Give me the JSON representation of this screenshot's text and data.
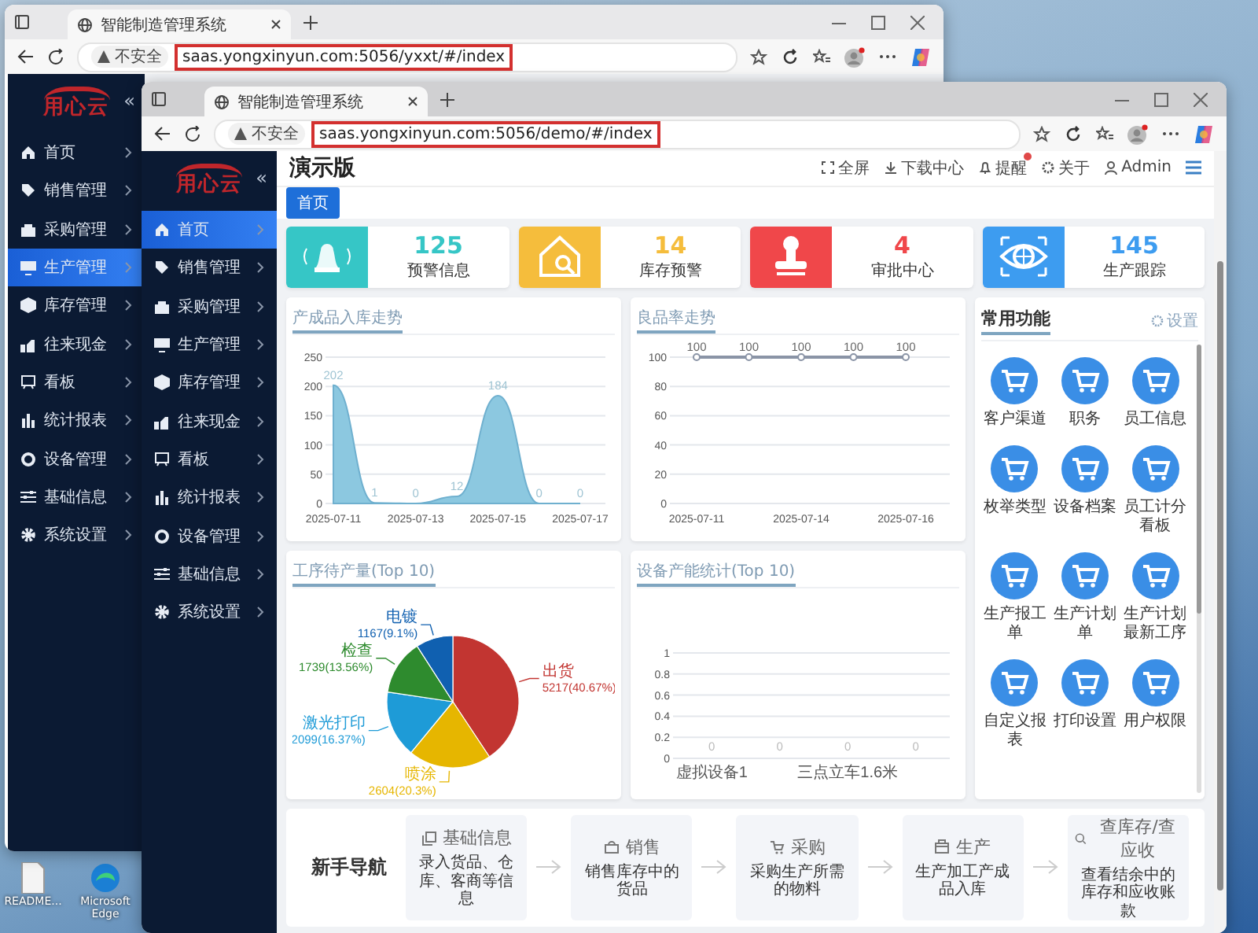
{
  "desktop": {
    "icons": [
      {
        "label": "README..."
      },
      {
        "label": "Microsoft Edge"
      }
    ]
  },
  "back_window": {
    "tab_title": "智能制造管理系统",
    "security": "不安全",
    "url": "saas.yongxinyun.com:5056/yxxt/#/index",
    "url_highlighted": true,
    "sidebar": {
      "logo": "用心云",
      "collapse": "«",
      "items": [
        {
          "label": "首页",
          "selected": false
        },
        {
          "label": "销售管理",
          "selected": false
        },
        {
          "label": "采购管理",
          "selected": false
        },
        {
          "label": "生产管理",
          "selected": true
        },
        {
          "label": "库存管理",
          "selected": false
        },
        {
          "label": "往来现金",
          "selected": false
        },
        {
          "label": "看板",
          "selected": false
        },
        {
          "label": "统计报表",
          "selected": false
        },
        {
          "label": "设备管理",
          "selected": false
        },
        {
          "label": "基础信息",
          "selected": false
        },
        {
          "label": "系统设置",
          "selected": false
        }
      ]
    }
  },
  "front_window": {
    "tab_title": "智能制造管理系统",
    "security": "不安全",
    "url": "saas.yongxinyun.com:5056/demo/#/index",
    "url_highlighted": true,
    "sidebar": {
      "logo": "用心云",
      "collapse": "«",
      "items": [
        {
          "label": "首页",
          "selected": true
        },
        {
          "label": "销售管理",
          "selected": false
        },
        {
          "label": "采购管理",
          "selected": false
        },
        {
          "label": "生产管理",
          "selected": false
        },
        {
          "label": "库存管理",
          "selected": false
        },
        {
          "label": "往来现金",
          "selected": false
        },
        {
          "label": "看板",
          "selected": false
        },
        {
          "label": "统计报表",
          "selected": false
        },
        {
          "label": "设备管理",
          "selected": false
        },
        {
          "label": "基础信息",
          "selected": false
        },
        {
          "label": "系统设置",
          "selected": false
        }
      ]
    },
    "header": {
      "title": "演示版",
      "actions": [
        {
          "label": "全屏",
          "badge": false
        },
        {
          "label": "下载中心",
          "badge": false
        },
        {
          "label": "提醒",
          "badge": true
        },
        {
          "label": "关于",
          "badge": false
        },
        {
          "label": "Admin",
          "badge": false
        }
      ]
    },
    "tags": [
      {
        "label": "首页",
        "selected": true
      }
    ],
    "stats": [
      {
        "value": "125",
        "label": "预警信息",
        "color": "#36c6c6"
      },
      {
        "value": "14",
        "label": "库存预警",
        "color": "#f5bd3c"
      },
      {
        "value": "4",
        "label": "审批中心",
        "color": "#f0474a"
      },
      {
        "value": "145",
        "label": "生产跟踪",
        "color": "#3d9cf0"
      }
    ],
    "charts": [
      {
        "title": "产成品入库走势",
        "chart_data": {
          "type": "area",
          "categories": [
            "2025-07-11",
            null,
            "2025-07-13",
            null,
            "2025-07-15",
            null,
            "2025-07-17"
          ],
          "series": [
            {
              "color": "#8cc8e0",
              "values": [
                202,
                1,
                0,
                12,
                184,
                0,
                0
              ]
            }
          ],
          "ylim": [
            0,
            250
          ],
          "yticks": [
            0,
            50,
            100,
            150,
            200,
            250
          ],
          "grid": true,
          "data_labels": true
        }
      },
      {
        "title": "良品率走势",
        "chart_data": {
          "type": "line",
          "categories": [
            "2025-07-11",
            null,
            "2025-07-14",
            null,
            "2025-07-16"
          ],
          "series": [
            {
              "color": "#8a94a6",
              "marker": true,
              "values": [
                100,
                100,
                100,
                100,
                100
              ]
            }
          ],
          "ylim": [
            0,
            100
          ],
          "yticks": [
            0,
            20,
            40,
            60,
            80,
            100
          ],
          "grid": true,
          "data_labels": true
        }
      },
      {
        "title": "工序待产量(Top 10)",
        "chart_data": {
          "type": "pie",
          "categories": [
            "出货",
            "喷涂",
            "激光打印",
            "检查",
            "电镀"
          ],
          "series": [
            {
              "values": [
                40.67,
                20.3,
                16.37,
                13.56,
                9.1
              ]
            }
          ],
          "colors": [
            "#c23531",
            "#e6b600",
            "#1e9bd7",
            "#2e8b2e",
            "#1060b0"
          ],
          "value_labels": [
            "5217(40.67%)",
            "2604(20.3%)",
            "2099(16.37%)",
            "1739(13.56%)",
            "1167(9.1%)"
          ]
        }
      },
      {
        "title": "设备产能统计(Top 10)",
        "chart_data": {
          "type": "bar",
          "categories": [
            "虚拟设备1",
            null,
            "三点立车1.6米",
            null
          ],
          "series": [
            {
              "color": "#5b8ff9",
              "values": [
                0,
                0,
                0,
                0
              ]
            }
          ],
          "ylim": [
            0,
            1
          ],
          "yticks": [
            0,
            0.2,
            0.4,
            0.6,
            0.8,
            1
          ],
          "grid": true,
          "data_labels": true
        }
      }
    ],
    "shortcuts": {
      "title": "常用功能",
      "settings": "设置",
      "items": [
        {
          "label": "客户渠道"
        },
        {
          "label": "职务"
        },
        {
          "label": "员工信息"
        },
        {
          "label": "枚举类型"
        },
        {
          "label": "设备档案"
        },
        {
          "label": "员工计分看板"
        },
        {
          "label": "生产报工单"
        },
        {
          "label": "生产计划单"
        },
        {
          "label": "生产计划最新工序"
        },
        {
          "label": "自定义报表"
        },
        {
          "label": "打印设置"
        },
        {
          "label": "用户权限"
        }
      ]
    },
    "guide": {
      "title": "新手导航",
      "steps": [
        {
          "title": "基础信息",
          "text": "录入货品、仓库、客商等信息"
        },
        {
          "title": "销售",
          "text": "销售库存中的货品"
        },
        {
          "title": "采购",
          "text": "采购生产所需的物料"
        },
        {
          "title": "生产",
          "text": "生产加工产成品入库"
        },
        {
          "title": "查库存/查应收",
          "text": "查看结余中的库存和应收账款"
        }
      ]
    }
  }
}
